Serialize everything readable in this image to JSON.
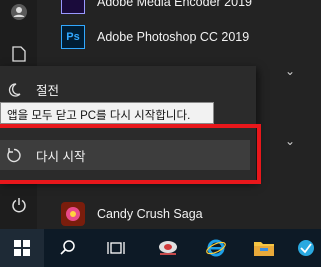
{
  "apps": [
    {
      "label": "Adobe Media Encoder 2019",
      "icon": "adobe-media-encoder-icon",
      "color": "#1a0b3b",
      "accent": "#9999ff"
    },
    {
      "label": "Adobe Photoshop CC 2019",
      "icon": "adobe-photoshop-icon",
      "color": "#001d34",
      "accent": "#31a8ff",
      "abbr": "Ps"
    },
    {
      "label": "Candy Crush Saga",
      "icon": "candy-crush-icon"
    }
  ],
  "power_menu": {
    "sleep_label": "절전",
    "tooltip": "앱을 모두 닫고 PC를 다시 시작합니다.",
    "restart_label": "다시 시작"
  },
  "colors": {
    "highlight": "#e8171b",
    "taskbar": "#0d1a26",
    "menu": "#2b2b2b"
  }
}
